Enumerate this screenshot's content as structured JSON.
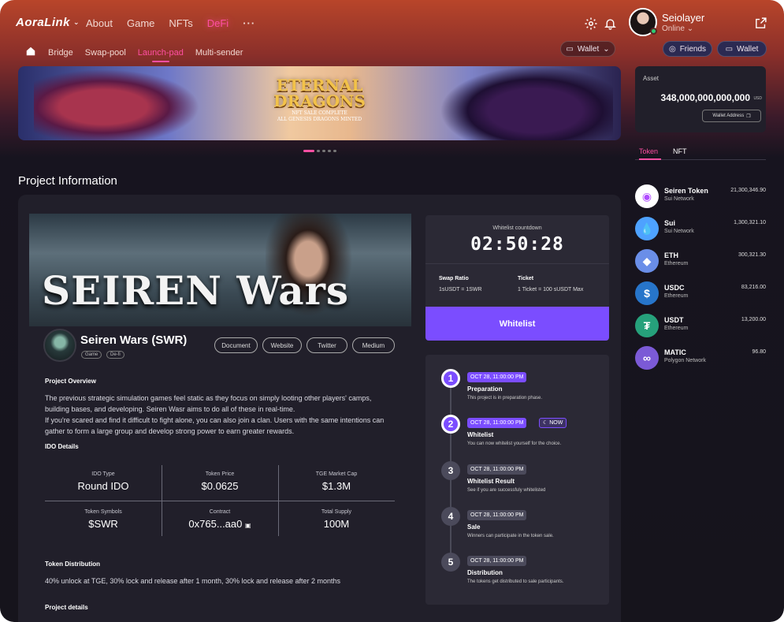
{
  "app": {
    "logo": "AoraLink",
    "logo_chevron": "chevron-down-icon"
  },
  "nav": {
    "items": [
      "About",
      "Game",
      "NFTs",
      "DeFi"
    ],
    "active": "DeFi",
    "more": "···"
  },
  "subnav": {
    "items": [
      "Bridge",
      "Swap-pool",
      "Launch-pad",
      "Multi-sender"
    ],
    "active": "Launch-pad",
    "wallet": "Wallet"
  },
  "user": {
    "name": "Seiolayer",
    "status": "Online",
    "friends": "Friends",
    "wallet": "Wallet"
  },
  "banner": {
    "title_line1": "ETERNAL",
    "title_line2": "DRAGONS",
    "sub_line1": "NFT SALE COMPLETE",
    "sub_line2": "ALL GENESIS DRAGONS MINTED"
  },
  "section": {
    "title": "Project Information"
  },
  "project": {
    "hero_title": "SEIREN Wars",
    "name": "Seiren Wars (SWR)",
    "tags": [
      "Game",
      "De-fi"
    ],
    "links": [
      "Document",
      "Website",
      "Twitter",
      "Medium"
    ],
    "overview_heading": "Project Overview",
    "overview_lines": [
      "The previous strategic simulation games feel static as they focus on simply looting other players' camps,",
      "building bases, and developing. Seiren Wasr aims to do all of these in real-time.",
      "If you're scared and find it difficult to fight alone, you can also join a clan. Users with the same intentions can",
      "gather to form a large group and develop strong power to earn greater rewards."
    ],
    "ido_heading": "IDO Details",
    "ido": [
      {
        "label": "IDO Type",
        "value": "Round IDO"
      },
      {
        "label": "Token Price",
        "value": "$0.0625"
      },
      {
        "label": "TGE Market Cap",
        "value": "$1.3M"
      },
      {
        "label": "Token Symbols",
        "value": "$SWR"
      },
      {
        "label": "Contract",
        "value": "0x765...aa0"
      },
      {
        "label": "Total Supply",
        "value": "100M"
      }
    ],
    "distribution_heading": "Token Distribution",
    "distribution_text": "40% unlock at TGE, 30% lock and release after 1 month, 30% lock and release after 2 months",
    "details_heading": "Project details"
  },
  "countdown": {
    "label": "Whitelist countdown",
    "time": "02:50:28",
    "swap_label": "Swap Ratio",
    "swap_value": "1sUSDT = 1SWR",
    "ticket_label": "Ticket",
    "ticket_value": "1 Ticket = 100 sUSDT Max",
    "button": "Whitelist"
  },
  "timeline": [
    {
      "num": "1",
      "date": "OCT 28, 11:00:00 PM",
      "title": "Preparation",
      "desc": "This project is in preparation phase.",
      "active": true
    },
    {
      "num": "2",
      "date": "OCT 28, 11:00:00 PM",
      "title": "Whitelist",
      "desc": "You can now whitelist yourself for the choice.",
      "active": true,
      "badge": "NOW"
    },
    {
      "num": "3",
      "date": "OCT 28, 11:00:00 PM",
      "title": "Whitelist Result",
      "desc": "See if you are successfuly whitelisted",
      "active": false
    },
    {
      "num": "4",
      "date": "OCT 28, 11:00:00 PM",
      "title": "Sale",
      "desc": "Winners can participate in the token sale.",
      "active": false
    },
    {
      "num": "5",
      "date": "OCT 28, 11:00:00 PM",
      "title": "Distribution",
      "desc": "The tokens get distributed to sale participants.",
      "active": false
    }
  ],
  "asset": {
    "label": "Asset",
    "value": "348,000,000,000,000",
    "unit": "USD",
    "address_button": "Wallet Address"
  },
  "right_tabs": {
    "token": "Token",
    "nft": "NFT",
    "active": "Token"
  },
  "tokens": [
    {
      "name": "Seiren Token",
      "network": "Sui Network",
      "amount": "21,300,346.90",
      "color": "#ffffff",
      "fg": "#b04bff",
      "icon": "seiren-icon"
    },
    {
      "name": "Sui",
      "network": "Sui Network",
      "amount": "1,300,321.10",
      "color": "#4ea2ff",
      "fg": "#ffffff",
      "icon": "sui-drop-icon"
    },
    {
      "name": "ETH",
      "network": "Ethereum",
      "amount": "300,321.30",
      "color": "#6a8ee8",
      "fg": "#ffffff",
      "icon": "eth-icon"
    },
    {
      "name": "USDC",
      "network": "Ethereum",
      "amount": "83,216.00",
      "color": "#2775ca",
      "fg": "#ffffff",
      "icon": "usdc-icon"
    },
    {
      "name": "USDT",
      "network": "Ethereum",
      "amount": "13,200.00",
      "color": "#26a17b",
      "fg": "#ffffff",
      "icon": "usdt-icon"
    },
    {
      "name": "MATIC",
      "network": "Polygon Network",
      "amount": "96.80",
      "color": "#7b5ad6",
      "fg": "#ffffff",
      "icon": "matic-icon"
    }
  ],
  "colors": {
    "accent": "#ff4fa3",
    "primary": "#7b4dff",
    "panel": "#211f2a",
    "card": "#2b2935"
  }
}
